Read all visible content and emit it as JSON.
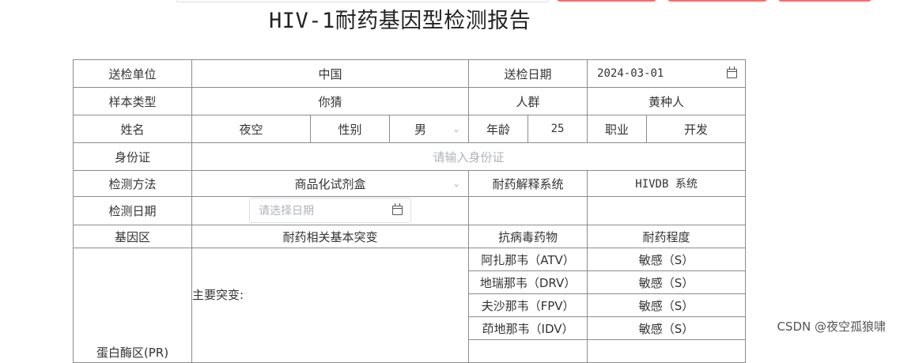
{
  "page": {
    "title": "HIV-1耐药基因型检测报告"
  },
  "labels": {
    "unit": "送检单位",
    "send_date": "送检日期",
    "sample_type": "样本类型",
    "population": "人群",
    "name": "姓名",
    "gender": "性别",
    "age": "年龄",
    "occupation": "职业",
    "id_card": "身份证",
    "method": "检测方法",
    "interp_system": "耐药解释系统",
    "test_date": "检测日期",
    "gene_region": "基因区",
    "mutations_header": "耐药相关基本突变",
    "drug_header": "抗病毒药物",
    "level_header": "耐药程度",
    "major_mutation": "主要突变:",
    "region_pr": "蛋白酶区(PR)"
  },
  "values": {
    "unit": "中国",
    "send_date": "2024-03-01",
    "sample_type": "你猜",
    "population": "黄种人",
    "name": "夜空",
    "gender": "男",
    "age": "25",
    "occupation": "开发",
    "method": "商品化试剂盒",
    "interp_system": "HIVDB 系统"
  },
  "placeholders": {
    "id_card": "请输入身份证",
    "test_date": "请选择日期"
  },
  "drugs": [
    {
      "name": "阿扎那韦（ATV）",
      "level": "敏感（S）"
    },
    {
      "name": "地瑞那韦（DRV）",
      "level": "敏感（S）"
    },
    {
      "name": "夫沙那韦（FPV）",
      "level": "敏感（S）"
    },
    {
      "name": "茚地那韦（IDV）",
      "level": "敏感（S）"
    }
  ],
  "watermark": "CSDN @夜空孤狼啸",
  "colors": {
    "border": "#8c8c8c",
    "button": "#f56c6c",
    "placeholder": "#b0b3b8"
  },
  "icons": {
    "calendar": "calendar-icon",
    "chevron": "chevron-down-icon"
  }
}
